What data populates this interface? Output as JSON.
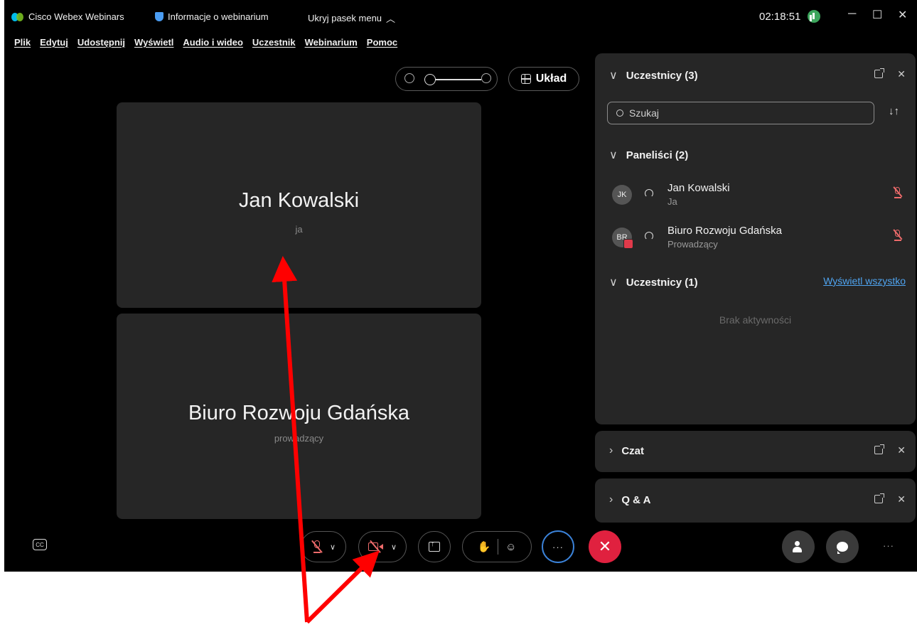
{
  "titlebar": {
    "app_name": "Cisco Webex Webinars",
    "info_label": "Informacje o webinarium",
    "hide_menu_label": "Ukryj pasek menu",
    "time": "02:18:51"
  },
  "menu": {
    "file": "Plik",
    "edit": "Edytuj",
    "share": "Udostępnij",
    "view": "Wyświetl",
    "audio_video": "Audio i wideo",
    "participant": "Uczestnik",
    "webinar": "Webinarium",
    "help": "Pomoc"
  },
  "toolbar": {
    "layout_label": "Układ"
  },
  "tiles": [
    {
      "name": "Jan Kowalski",
      "role": "ja"
    },
    {
      "name": "Biuro Rozwoju Gdańska",
      "role": "prowadzący"
    }
  ],
  "participants_panel": {
    "title": "Uczestnicy (3)",
    "search_placeholder": "Szukaj",
    "panelists_title": "Paneliści (2)",
    "panelists": [
      {
        "initials": "JK",
        "name": "Jan Kowalski",
        "role": "Ja"
      },
      {
        "initials": "BR",
        "name": "Biuro Rozwoju Gdańska",
        "role": "Prowadzący"
      }
    ],
    "attendees_title": "Uczestnicy (1)",
    "show_all": "Wyświetl wszystko",
    "empty_text": "Brak aktywności"
  },
  "chat_panel": {
    "title": "Czat"
  },
  "qa_panel": {
    "title": "Q & A"
  },
  "controls": {
    "cc_label": "CC",
    "more_label": "···"
  },
  "colors": {
    "accent": "#3b82d8",
    "leave": "#e0213f",
    "muted": "#ee6b6b",
    "link": "#4fa4f0",
    "annotation": "#ff0000"
  }
}
